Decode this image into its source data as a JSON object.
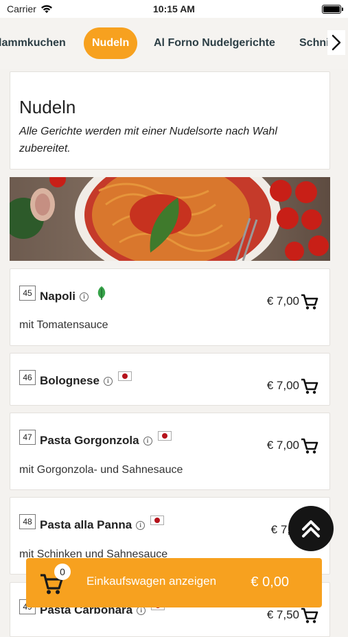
{
  "status_bar": {
    "carrier": "Carrier",
    "time": "10:15 AM"
  },
  "categories": [
    {
      "label": "lammkuchen",
      "active": false
    },
    {
      "label": "Nudeln",
      "active": true
    },
    {
      "label": "Al Forno Nudelgerichte",
      "active": false
    },
    {
      "label": "Schni",
      "active": false
    }
  ],
  "section": {
    "title": "Nudeln",
    "subtitle": "Alle Gerichte werden mit einer Nudelsorte nach Wahl zubereitet."
  },
  "items": [
    {
      "number": "45",
      "name": "Napoli",
      "badge": "leaf-icon",
      "description": "mit Tomatensauce",
      "price": "€ 7,00"
    },
    {
      "number": "46",
      "name": "Bolognese",
      "badge": "flag-icon",
      "description": "",
      "price": "€ 7,00"
    },
    {
      "number": "47",
      "name": "Pasta Gorgonzola",
      "badge": "flag-icon",
      "description": "mit Gorgonzola- und Sahnesauce",
      "price": "€ 7,00"
    },
    {
      "number": "48",
      "name": "Pasta alla Panna",
      "badge": "flag-icon",
      "description": "mit Schinken und Sahnesauce",
      "price": "€ 7,"
    },
    {
      "number": "49",
      "name": "Pasta Carbonara",
      "badge": "flag-icon",
      "description": "",
      "price": "€ 7,50"
    }
  ],
  "cart": {
    "count": "0",
    "label": "Einkaufswagen anzeigen",
    "total": "€ 0,00"
  },
  "colors": {
    "accent": "#f7a11f",
    "dark": "#151515",
    "tab_text": "#2c3e45"
  }
}
